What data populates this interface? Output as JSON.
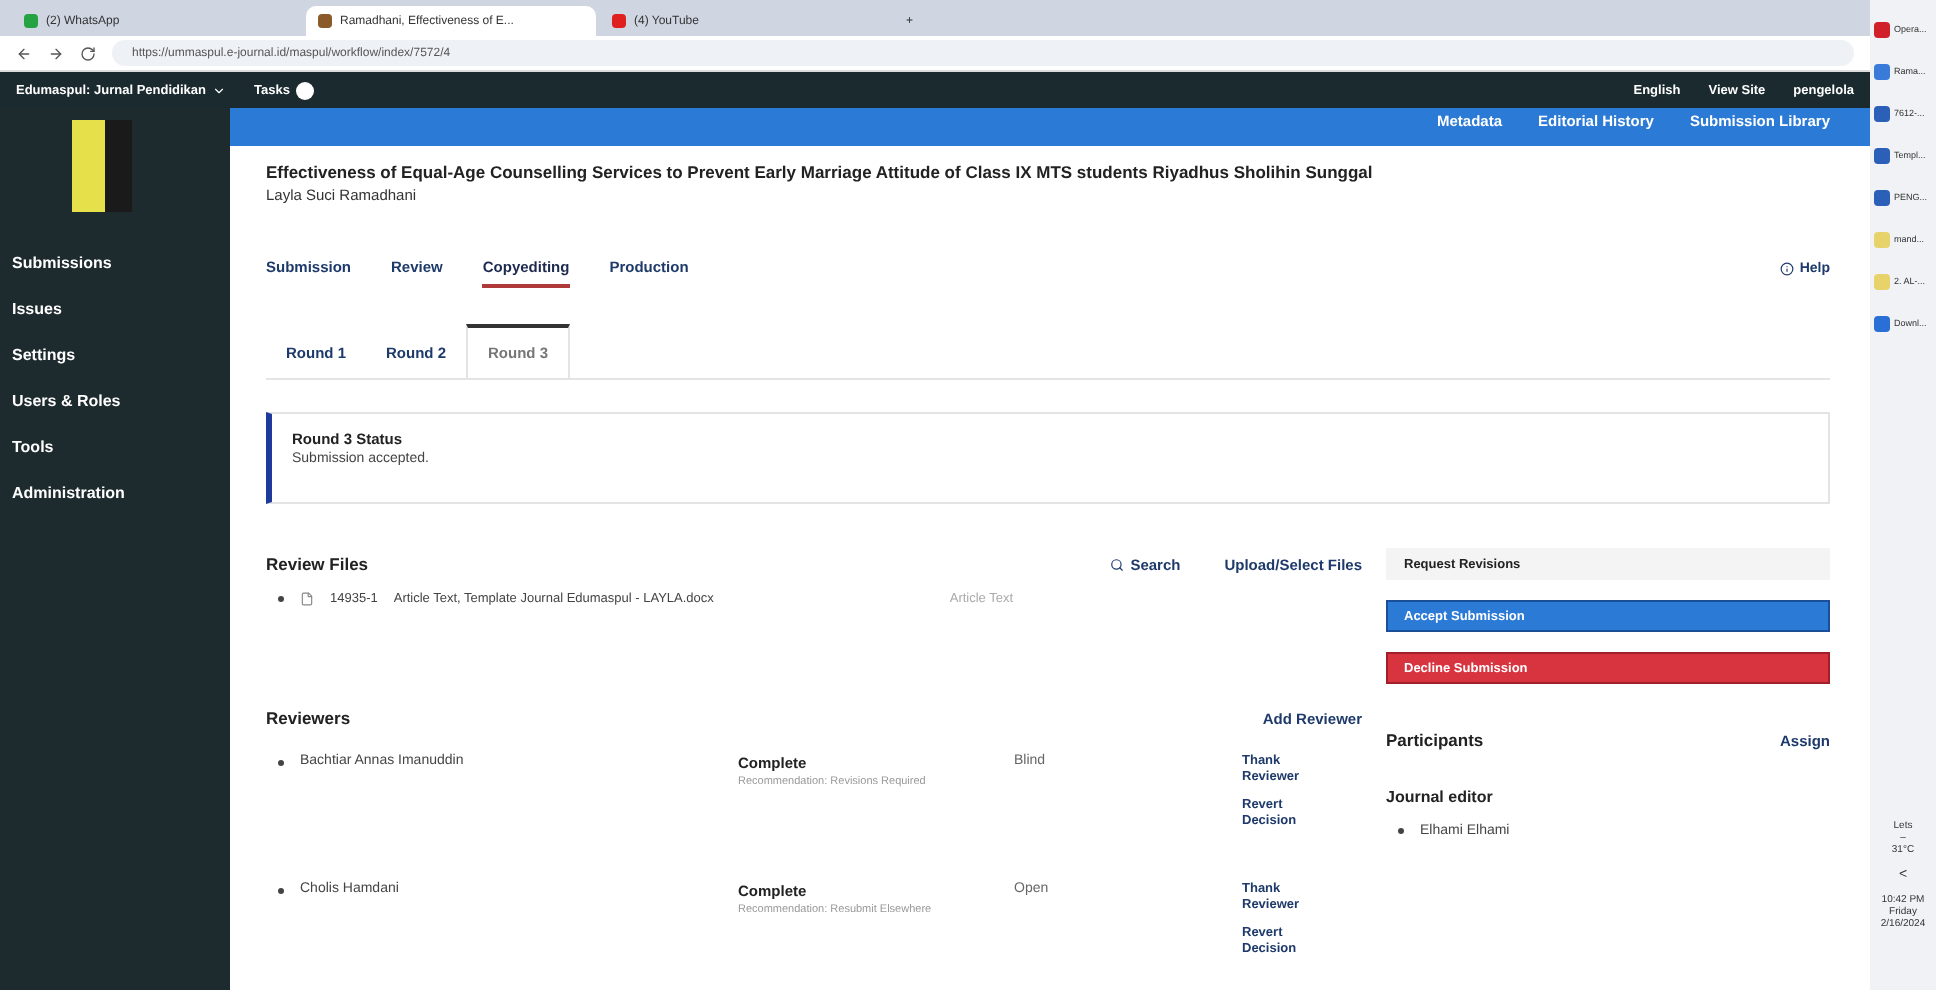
{
  "browser": {
    "tabs": [
      {
        "label": "(2) WhatsApp",
        "selected": false,
        "color": "#25a244"
      },
      {
        "label": "Ramadhani, Effectiveness of E...",
        "selected": true,
        "color": "#8a5a2b"
      },
      {
        "label": "(4) YouTube",
        "selected": false,
        "color": "#e02020"
      }
    ],
    "new_tab": "+",
    "url": "https://ummaspul.e-journal.id/maspul/workflow/index/7572/4"
  },
  "topbar": {
    "journal": "Edumaspul: Jurnal Pendidikan",
    "tasks": "Tasks",
    "language": "English",
    "view_site": "View Site",
    "user": "pengelola"
  },
  "sidebar": {
    "items": [
      {
        "label": "Submissions"
      },
      {
        "label": "Issues"
      },
      {
        "label": "Settings"
      },
      {
        "label": "Users & Roles"
      },
      {
        "label": "Tools"
      },
      {
        "label": "Administration"
      }
    ]
  },
  "header_links": [
    "Metadata",
    "Editorial History",
    "Submission Library"
  ],
  "submission": {
    "title": "Effectiveness of Equal-Age Counselling Services to Prevent Early Marriage Attitude of Class IX MTS students Riyadhus Sholihin Sunggal",
    "author": "Layla Suci Ramadhani"
  },
  "stage_tabs": [
    {
      "label": "Submission",
      "selected": false
    },
    {
      "label": "Review",
      "selected": false
    },
    {
      "label": "Copyediting",
      "selected": true
    },
    {
      "label": "Production",
      "selected": false
    }
  ],
  "help": "Help",
  "round_tabs": [
    {
      "label": "Round 1",
      "selected": false
    },
    {
      "label": "Round 2",
      "selected": false
    },
    {
      "label": "Round 3",
      "selected": true
    }
  ],
  "status": {
    "title": "Round 3 Status",
    "text": "Submission accepted."
  },
  "review_files": {
    "title": "Review Files",
    "search": "Search",
    "upload": "Upload/Select Files",
    "files": [
      {
        "id": "14935-1",
        "name": "Article Text, Template Journal Edumaspul - LAYLA.docx",
        "type": "Article Text"
      }
    ]
  },
  "decisions": [
    {
      "label": "Request Revisions",
      "kind": "plain"
    },
    {
      "label": "Accept Submission",
      "kind": "primary"
    },
    {
      "label": "Decline Submission",
      "kind": "danger"
    }
  ],
  "reviewers": {
    "title": "Reviewers",
    "add": "Add Reviewer",
    "rows": [
      {
        "name": "Bachtiar Annas Imanuddin",
        "status": "Complete",
        "recommendation": "Recommendation: Revisions Required",
        "method": "Blind",
        "actions": [
          "Thank Reviewer",
          "Revert Decision"
        ]
      },
      {
        "name": "Cholis Hamdani",
        "status": "Complete",
        "recommendation": "Recommendation: Resubmit Elsewhere",
        "method": "Open",
        "actions": [
          "Thank Reviewer",
          "Revert Decision"
        ]
      }
    ]
  },
  "participants": {
    "title": "Participants",
    "assign": "Assign",
    "groups": [
      {
        "role": "Journal editor",
        "people": [
          "Elhami Elhami"
        ]
      }
    ]
  },
  "taskbar": {
    "items": [
      {
        "label": "Opera...",
        "color": "#d0202a"
      },
      {
        "label": "Rama...",
        "color": "#3a7ad8"
      },
      {
        "label": "7612-...",
        "color": "#2b5fb8"
      },
      {
        "label": "Templ...",
        "color": "#2b5fb8"
      },
      {
        "label": "PENG...",
        "color": "#2b5fb8"
      },
      {
        "label": "mand...",
        "color": "#e8d36a"
      },
      {
        "label": "2. AL-...",
        "color": "#e8d36a"
      },
      {
        "label": "Downl...",
        "color": "#2a6fd6"
      }
    ],
    "weather_label": "Lets",
    "weather_sub": "–",
    "temperature": "31°C",
    "chevron": "<",
    "time": "10:42 PM",
    "day": "Friday",
    "date": "2/16/2024"
  }
}
